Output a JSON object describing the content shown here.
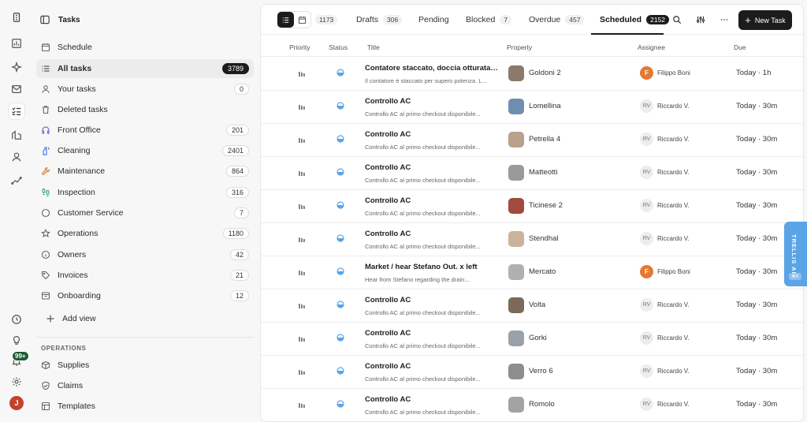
{
  "rail": {
    "badge": "99+",
    "avatar_initial": "J",
    "icons": [
      "building-icon",
      "analytics-icon",
      "sparkle-icon",
      "inbox-icon",
      "tasks-icon",
      "properties-icon",
      "person-icon",
      "trend-icon",
      "clock-icon",
      "lightbulb-icon",
      "bell-icon",
      "settings-icon"
    ]
  },
  "sidebar": {
    "title": "Tasks",
    "items": [
      {
        "label": "Schedule",
        "count": "",
        "icon": "calendar-icon"
      },
      {
        "label": "All tasks",
        "count": "3789",
        "icon": "list-icon"
      },
      {
        "label": "Your tasks",
        "count": "0",
        "icon": "user-icon"
      },
      {
        "label": "Deleted tasks",
        "count": "",
        "icon": "trash-icon"
      },
      {
        "label": "Front Office",
        "count": "201",
        "icon": "headset-icon"
      },
      {
        "label": "Cleaning",
        "count": "2401",
        "icon": "spray-icon"
      },
      {
        "label": "Maintenance",
        "count": "864",
        "icon": "wrench-icon"
      },
      {
        "label": "Inspection",
        "count": "316",
        "icon": "footprints-icon"
      },
      {
        "label": "Customer Service",
        "count": "7",
        "icon": "circle-icon"
      },
      {
        "label": "Operations",
        "count": "1180",
        "icon": "star-icon"
      },
      {
        "label": "Owners",
        "count": "42",
        "icon": "info-icon"
      },
      {
        "label": "Invoices",
        "count": "21",
        "icon": "tag-icon"
      },
      {
        "label": "Onboarding",
        "count": "12",
        "icon": "archive-icon"
      }
    ],
    "add_view": "Add view",
    "section_label": "OPERATIONS",
    "section_items": [
      {
        "label": "Supplies",
        "icon": "box-icon"
      },
      {
        "label": "Claims",
        "icon": "shield-check-icon"
      },
      {
        "label": "Templates",
        "icon": "template-icon"
      }
    ]
  },
  "toolbar": {
    "tabs": [
      {
        "label": "",
        "count": "1173"
      },
      {
        "label": "Drafts",
        "count": "306"
      },
      {
        "label": "Pending",
        "count": ""
      },
      {
        "label": "Blocked",
        "count": "7"
      },
      {
        "label": "Overdue",
        "count": "457"
      },
      {
        "label": "Scheduled",
        "count": "2152"
      }
    ],
    "new_task": "New Task"
  },
  "table": {
    "columns": {
      "priority": "Priority",
      "status": "Status",
      "title": "Title",
      "property": "Property",
      "assignee": "Assignee",
      "due": "Due"
    },
    "rows": [
      {
        "title": "Contatore staccato, doccia otturata e...",
        "sub": "Il contatore è staccato per supero potenza. L...",
        "property": "Goldoni 2",
        "assignee": "Filippo Boni",
        "initials": "F",
        "due": "Today · 1h"
      },
      {
        "title": "Controllo AC",
        "sub": "Controllo AC al primo checkout disponibile...",
        "property": "Lomellina",
        "assignee": "Riccardo V.",
        "initials": "RV",
        "due": "Today · 30m"
      },
      {
        "title": "Controllo AC",
        "sub": "Controllo AC al primo checkout disponibile...",
        "property": "Petrella 4",
        "assignee": "Riccardo V.",
        "initials": "RV",
        "due": "Today · 30m"
      },
      {
        "title": "Controllo AC",
        "sub": "Controllo AC al primo checkout disponibile...",
        "property": "Matteotti",
        "assignee": "Riccardo V.",
        "initials": "RV",
        "due": "Today · 30m"
      },
      {
        "title": "Controllo AC",
        "sub": "Controllo AC al primo checkout disponibile...",
        "property": "Ticinese 2",
        "assignee": "Riccardo V.",
        "initials": "RV",
        "due": "Today · 30m"
      },
      {
        "title": "Controllo AC",
        "sub": "Controllo AC al primo checkout disponibile...",
        "property": "Stendhal",
        "assignee": "Riccardo V.",
        "initials": "RV",
        "due": "Today · 30m"
      },
      {
        "title": "Market / hear Stefano Out. x left",
        "sub": "Hear from Stefano regarding the drain...",
        "property": "Mercato",
        "assignee": "Filippo Boni",
        "initials": "F",
        "due": "Today · 30m"
      },
      {
        "title": "Controllo AC",
        "sub": "Controllo AC al primo checkout disponibile...",
        "property": "Volta",
        "assignee": "Riccardo V.",
        "initials": "RV",
        "due": "Today · 30m"
      },
      {
        "title": "Controllo AC",
        "sub": "Controllo AC al primo checkout disponibile...",
        "property": "Gorki",
        "assignee": "Riccardo V.",
        "initials": "RV",
        "due": "Today · 30m"
      },
      {
        "title": "Controllo AC",
        "sub": "Controllo AC al primo checkout disponibile...",
        "property": "Verro 6",
        "assignee": "Riccardo V.",
        "initials": "RV",
        "due": "Today · 30m"
      },
      {
        "title": "Controllo AC",
        "sub": "Controllo AC al primo checkout disponibile...",
        "property": "Romolo",
        "assignee": "Riccardo V.",
        "initials": "RV",
        "due": "Today · 30m"
      }
    ]
  },
  "trellis": {
    "label": "TRELLIS AI",
    "shortcut": "⌘K"
  },
  "colors": {
    "accent": "#1c1c1c",
    "trellis": "#5aa4e6",
    "status_blue": "#5aa4e6",
    "assignee_orange": "#e57932"
  }
}
